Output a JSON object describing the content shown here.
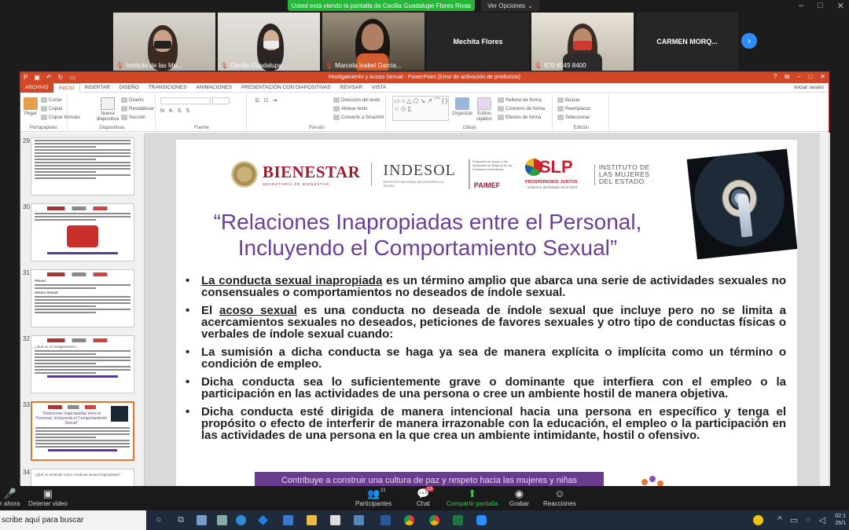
{
  "zoom": {
    "share_banner": "Usted está viendo la pantalla de Cecilia Guadalupe Flores Rivas",
    "view_options": "Ver Opciones",
    "participants": [
      {
        "name": "Instituto de las Mu...",
        "muted": true
      },
      {
        "name": "Cecilia Guadalupe ...",
        "muted": true
      },
      {
        "name": "Marcela Isabel Garcia...",
        "muted": true
      },
      {
        "name": "Mechita Flores",
        "muted": false
      },
      {
        "name": "870 6049 8400",
        "muted": true
      },
      {
        "name": "CARMEN  MORQ...",
        "muted": false
      }
    ],
    "toolbar": {
      "start": "r ahora",
      "stop_video": "Detener video",
      "participants": "Participantes",
      "participants_count": "21",
      "chat": "Chat",
      "chat_badge": "13",
      "share": "Compartir pantalla",
      "record": "Grabar",
      "reactions": "Reacciones"
    }
  },
  "ppt": {
    "window_title": "Hostigamiento y Acoso Sexual - PowerPoint (Error de activación de productos)",
    "sign_in": "Iniciar sesión",
    "tabs": [
      "ARCHIVO",
      "INICIO",
      "INSERTAR",
      "DISEÑO",
      "TRANSICIONES",
      "ANIMACIONES",
      "PRESENTACIÓN CON DIAPOSITIVAS",
      "REVISAR",
      "VISTA"
    ],
    "ribbon": {
      "paste": "Pegar",
      "cut": "Cortar",
      "copy": "Copiar",
      "format_painter": "Copiar formato",
      "clipboard": "Portapapeles",
      "new_slide": "Nueva diapositiva",
      "layout": "Diseño",
      "reset": "Restablecer",
      "section": "Sección",
      "slides": "Diapositivas",
      "font": "Fuente",
      "text_direction": "Dirección del texto",
      "align_text": "Alinear texto",
      "smartart": "Convertir a SmartArt",
      "paragraph": "Párrafo",
      "arrange": "Organizar",
      "quick_styles": "Estilos rápidos",
      "shape_fill": "Relleno de forma",
      "shape_outline": "Contorno de forma",
      "shape_effects": "Efectos de forma",
      "drawing": "Dibujo",
      "find": "Buscar",
      "replace": "Reemplazar",
      "select": "Seleccionar",
      "editing": "Edición"
    },
    "thumbnails": [
      {
        "num": "29"
      },
      {
        "num": "30"
      },
      {
        "num": "31",
        "heading": "Abuso",
        "sub": "Abuso Sexual"
      },
      {
        "num": "32",
        "q1": "¿Qué es el hostigamiento?"
      },
      {
        "num": "33",
        "title": "“Relaciones Inapropiadas entre el Personal, Incluyendo el Comportamiento Sexual”",
        "active": true
      },
      {
        "num": "34",
        "q": "¿Qué se entiende como conducta sexual inapropiada?"
      }
    ],
    "slide": {
      "bienestar": "BIENESTAR",
      "bienestar_sub": "SECRETARÍA DE BIENESTAR",
      "indesol": "INDESOL",
      "indesol_sub": "INSTITUTO NACIONAL DE DESARROLLO SOCIAL",
      "paimef_text": "Programa de Apoyo a las Instancias de Mujeres en las Entidades Federativas",
      "paimef": "PAIMEF",
      "slp": "SLP",
      "slp_sub": "PROSPEREMOS JUNTOS",
      "slp_sub2": "Gobierno del Estado 2015-2021",
      "instituto": "INSTITUTO DE LAS MUJERES DEL ESTADO",
      "title_line1": "“Relaciones Inapropiadas entre el Personal,",
      "title_line2": "Incluyendo el Comportamiento Sexual”",
      "b1_u": "La conducta sexual inapropiada",
      "b1_rest": " es un término amplio que abarca una serie de actividades sexuales no consensuales o comportamientos no deseados de índole sexual.",
      "b2_pre": "El ",
      "b2_u": "acoso sexual",
      "b2_rest": " es una conducta no deseada de índole sexual que incluye pero no se limita a acercamientos sexuales no deseados, peticiones de favores sexuales y otro tipo de conductas físicas o verbales de índole sexual cuando:",
      "b3": "La sumisión a dicha conducta se haga ya sea de manera explícita o implícita como un término o condición de empleo.",
      "b4": "Dicha conducta sea lo suficientemente grave o dominante que interfiera con el empleo o la participación en las actividades de una persona o cree un ambiente hostil de manera objetiva.",
      "b5": "Dicha conducta esté dirigida de manera intencional hacia una persona en específico y tenga el propósito o efecto de interferir de manera irrazonable con la educación, el empleo o la participación en las actividades de una persona en la que crea un ambiente intimidante, hostil o ofensivo.",
      "footer": "Contribuye a construir una cultura de paz y respeto hacia las mujeres y niñas"
    }
  },
  "taskbar": {
    "search": "scribe aquí para buscar",
    "time": "02:1",
    "date": "26/1"
  }
}
